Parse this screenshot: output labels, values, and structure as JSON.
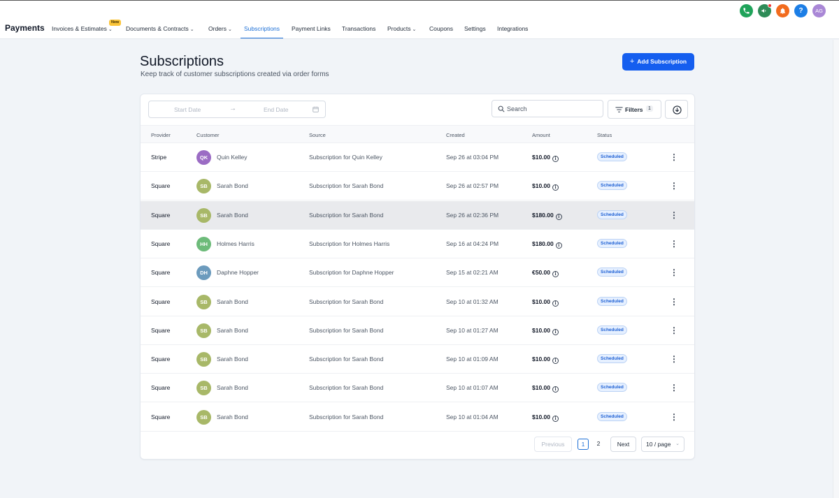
{
  "app": {
    "title": "Payments"
  },
  "nav": {
    "items": [
      {
        "label": "Invoices & Estimates",
        "dropdown": true,
        "active": false
      },
      {
        "label": "Documents & Contracts",
        "dropdown": true,
        "active": false
      },
      {
        "label": "Orders",
        "dropdown": true,
        "active": false
      },
      {
        "label": "Subscriptions",
        "dropdown": false,
        "active": true
      },
      {
        "label": "Payment Links",
        "dropdown": false,
        "active": false
      },
      {
        "label": "Transactions",
        "dropdown": false,
        "active": false
      },
      {
        "label": "Products",
        "dropdown": true,
        "active": false
      },
      {
        "label": "Coupons",
        "dropdown": false,
        "active": false
      },
      {
        "label": "Settings",
        "dropdown": false,
        "active": false
      },
      {
        "label": "Integrations",
        "dropdown": false,
        "active": false
      }
    ],
    "new_badge": "New"
  },
  "top_icons": {
    "phone": {
      "icon": "phone-icon",
      "color": "#1fa35a"
    },
    "announce": {
      "icon": "megaphone-icon",
      "color": "#2e8b57"
    },
    "bell": {
      "icon": "bell-icon",
      "color": "#f26b1d"
    },
    "help": {
      "icon": "help-icon",
      "label": "?",
      "color": "#1c7ee6"
    },
    "avatar": {
      "initials": "AG",
      "color": "#a987d6"
    }
  },
  "page": {
    "title": "Subscriptions",
    "subtitle": "Keep track of customer subscriptions created via order forms",
    "add_button": "Add Subscription"
  },
  "toolbar": {
    "start_date_placeholder": "Start Date",
    "end_date_placeholder": "End Date",
    "search_placeholder": "Search",
    "filters_label": "Filters",
    "filters_count": "1"
  },
  "table": {
    "columns": [
      "Provider",
      "Customer",
      "Source",
      "Created",
      "Amount",
      "Status"
    ],
    "rows": [
      {
        "provider": "Stripe",
        "initials": "QK",
        "avatar_color": "#9b6cc4",
        "customer": "Quin Kelley",
        "source": "Subscription for Quin Kelley",
        "created": "Sep 26 at 03:04 PM",
        "amount": "$10.00",
        "status": "Scheduled"
      },
      {
        "provider": "Square",
        "initials": "SB",
        "avatar_color": "#a8b868",
        "customer": "Sarah Bond",
        "source": "Subscription for Sarah Bond",
        "created": "Sep 26 at 02:57 PM",
        "amount": "$10.00",
        "status": "Scheduled"
      },
      {
        "provider": "Square",
        "initials": "SB",
        "avatar_color": "#a8b868",
        "customer": "Sarah Bond",
        "source": "Subscription for Sarah Bond",
        "created": "Sep 26 at 02:36 PM",
        "amount": "$180.00",
        "status": "Scheduled"
      },
      {
        "provider": "Square",
        "initials": "HH",
        "avatar_color": "#6dbb7a",
        "customer": "Holmes Harris",
        "source": "Subscription for Holmes Harris",
        "created": "Sep 16 at 04:24 PM",
        "amount": "$180.00",
        "status": "Scheduled"
      },
      {
        "provider": "Square",
        "initials": "DH",
        "avatar_color": "#6c9bbd",
        "customer": "Daphne Hopper",
        "source": "Subscription for Daphne Hopper",
        "created": "Sep 15 at 02:21 AM",
        "amount": "€50.00",
        "status": "Scheduled"
      },
      {
        "provider": "Square",
        "initials": "SB",
        "avatar_color": "#a8b868",
        "customer": "Sarah Bond",
        "source": "Subscription for Sarah Bond",
        "created": "Sep 10 at 01:32 AM",
        "amount": "$10.00",
        "status": "Scheduled"
      },
      {
        "provider": "Square",
        "initials": "SB",
        "avatar_color": "#a8b868",
        "customer": "Sarah Bond",
        "source": "Subscription for Sarah Bond",
        "created": "Sep 10 at 01:27 AM",
        "amount": "$10.00",
        "status": "Scheduled"
      },
      {
        "provider": "Square",
        "initials": "SB",
        "avatar_color": "#a8b868",
        "customer": "Sarah Bond",
        "source": "Subscription for Sarah Bond",
        "created": "Sep 10 at 01:09 AM",
        "amount": "$10.00",
        "status": "Scheduled"
      },
      {
        "provider": "Square",
        "initials": "SB",
        "avatar_color": "#a8b868",
        "customer": "Sarah Bond",
        "source": "Subscription for Sarah Bond",
        "created": "Sep 10 at 01:07 AM",
        "amount": "$10.00",
        "status": "Scheduled"
      },
      {
        "provider": "Square",
        "initials": "SB",
        "avatar_color": "#a8b868",
        "customer": "Sarah Bond",
        "source": "Subscription for Sarah Bond",
        "created": "Sep 10 at 01:04 AM",
        "amount": "$10.00",
        "status": "Scheduled"
      }
    ],
    "highlighted_row": 2
  },
  "pagination": {
    "previous": "Previous",
    "pages": [
      "1",
      "2"
    ],
    "current": "1",
    "next": "Next",
    "page_size": "10 / page"
  }
}
